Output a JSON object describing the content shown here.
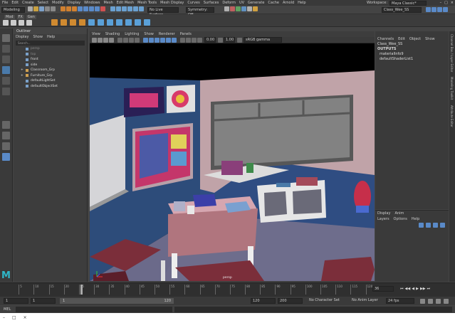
{
  "menubar": {
    "items": [
      "File",
      "Edit",
      "Create",
      "Select",
      "Modify",
      "Display",
      "Windows",
      "Mesh",
      "Edit Mesh",
      "Mesh Tools",
      "Mesh Display",
      "Curves",
      "Surfaces",
      "Deform",
      "UV",
      "Generate",
      "Cache",
      "Arnold",
      "Help"
    ],
    "workspace_label": "Workspace:",
    "workspace_value": "Maya Classic*",
    "window_controls": [
      "–",
      "□",
      "×"
    ]
  },
  "statusline": {
    "mode": "Modeling",
    "no_live": "No Live Surface",
    "symmetry": "Symmetry: Off",
    "scene_name": "Class_Wee_SS"
  },
  "shelf": {
    "tabs": [
      "Mod",
      "FX",
      "Gen"
    ]
  },
  "outliner": {
    "title": "Outliner",
    "menus": [
      "Display",
      "Show",
      "Help"
    ],
    "search_placeholder": "Search...",
    "items": [
      {
        "name": "persp",
        "dim": true,
        "exp": ""
      },
      {
        "name": "top",
        "dim": true,
        "exp": ""
      },
      {
        "name": "front",
        "dim": false,
        "exp": ""
      },
      {
        "name": "side",
        "dim": false,
        "exp": ""
      },
      {
        "name": "Classroom_Grp",
        "dim": false,
        "exp": "+"
      },
      {
        "name": "Furniture_Grp",
        "dim": false,
        "exp": "+"
      },
      {
        "name": "defaultLightSet",
        "dim": false,
        "exp": ""
      },
      {
        "name": "defaultObjectSet",
        "dim": false,
        "exp": ""
      }
    ]
  },
  "viewport": {
    "menus": [
      "View",
      "Shading",
      "Lighting",
      "Show",
      "Renderer",
      "Panels"
    ],
    "near": "0.00",
    "far": "1.00",
    "colorspace": "sRGB gamma",
    "camera_label": "persp"
  },
  "channelbox": {
    "menus": [
      "Channels",
      "Edit",
      "Object",
      "Show"
    ],
    "object": "Class_Wee_SS",
    "outputs_label": "OUTPUTS",
    "outputs": [
      "materialInfo9",
      "defaultShaderList1"
    ]
  },
  "layers": {
    "tabs": [
      "Display",
      "Anim"
    ],
    "menus": [
      "Layers",
      "Options",
      "Help"
    ]
  },
  "sidetabs": [
    "Channel Box / Layer Editor",
    "Modeling Toolkit",
    "Attribute Editor"
  ],
  "timeline": {
    "ticks": [
      "5",
      "10",
      "15",
      "20",
      "25",
      "30",
      "35",
      "40",
      "45",
      "50",
      "55",
      "60",
      "65",
      "70",
      "75",
      "80",
      "85",
      "90",
      "95",
      "100",
      "105",
      "110",
      "115",
      "120"
    ],
    "current_frame": "36"
  },
  "range": {
    "start": "1",
    "start2": "1",
    "slider_start": "1",
    "slider_end": "120",
    "end": "120",
    "end2": "200",
    "character": "No Character Set",
    "anim_layer": "No Anim Layer",
    "fps": "24 fps"
  },
  "mel": {
    "label": "MEL"
  },
  "logo": "M"
}
